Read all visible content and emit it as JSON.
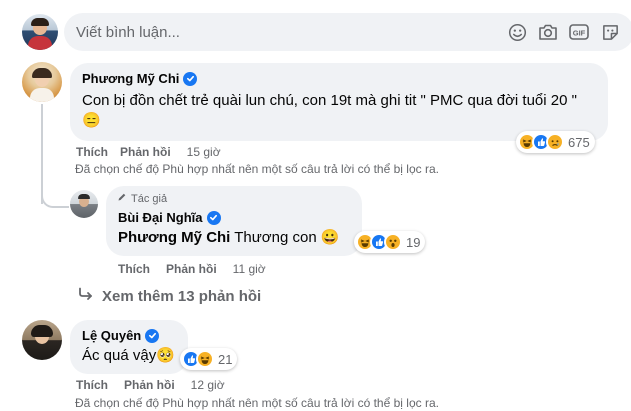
{
  "composer": {
    "placeholder": "Viết bình luận...",
    "icons": [
      "emoji-icon",
      "camera-icon",
      "gif-icon",
      "sticker-icon"
    ]
  },
  "comments": [
    {
      "author": "Phương Mỹ Chi",
      "verified": true,
      "text": "Con bị đồn chết trẻ quài lun chú, con 19t mà ghi tit \" PMC qua đời tuổi 20 \" 😑",
      "like_label": "Thích",
      "reply_label": "Phản hồi",
      "time": "15 giờ",
      "reactions": [
        "haha",
        "like",
        "sad"
      ],
      "reaction_count": "675",
      "filter_note": "Đã chọn chế độ Phù hợp nhất nên một số câu trả lời có thể bị lọc ra.",
      "reply": {
        "badge": "Tác giả",
        "author": "Bùi Đại Nghĩa",
        "verified": true,
        "mention": "Phương Mỹ Chi",
        "text": "Thương con 😀",
        "like_label": "Thích",
        "reply_label": "Phản hồi",
        "time": "11 giờ",
        "reactions": [
          "haha",
          "like",
          "wow"
        ],
        "reaction_count": "19"
      },
      "more_replies": "Xem thêm 13 phản hồi"
    },
    {
      "author": "Lệ Quyên",
      "verified": true,
      "text": "Ác quá vậy🥺",
      "like_label": "Thích",
      "reply_label": "Phản hồi",
      "time": "12 giờ",
      "reactions": [
        "like",
        "haha"
      ],
      "reaction_count": "21",
      "filter_note": "Đã chọn chế độ Phù hợp nhất nên một số câu trả lời có thể bị lọc ra."
    }
  ],
  "colors": {
    "link_blue": "#1877f2",
    "bubble_bg": "#f0f2f5",
    "secondary_text": "#65676b"
  }
}
